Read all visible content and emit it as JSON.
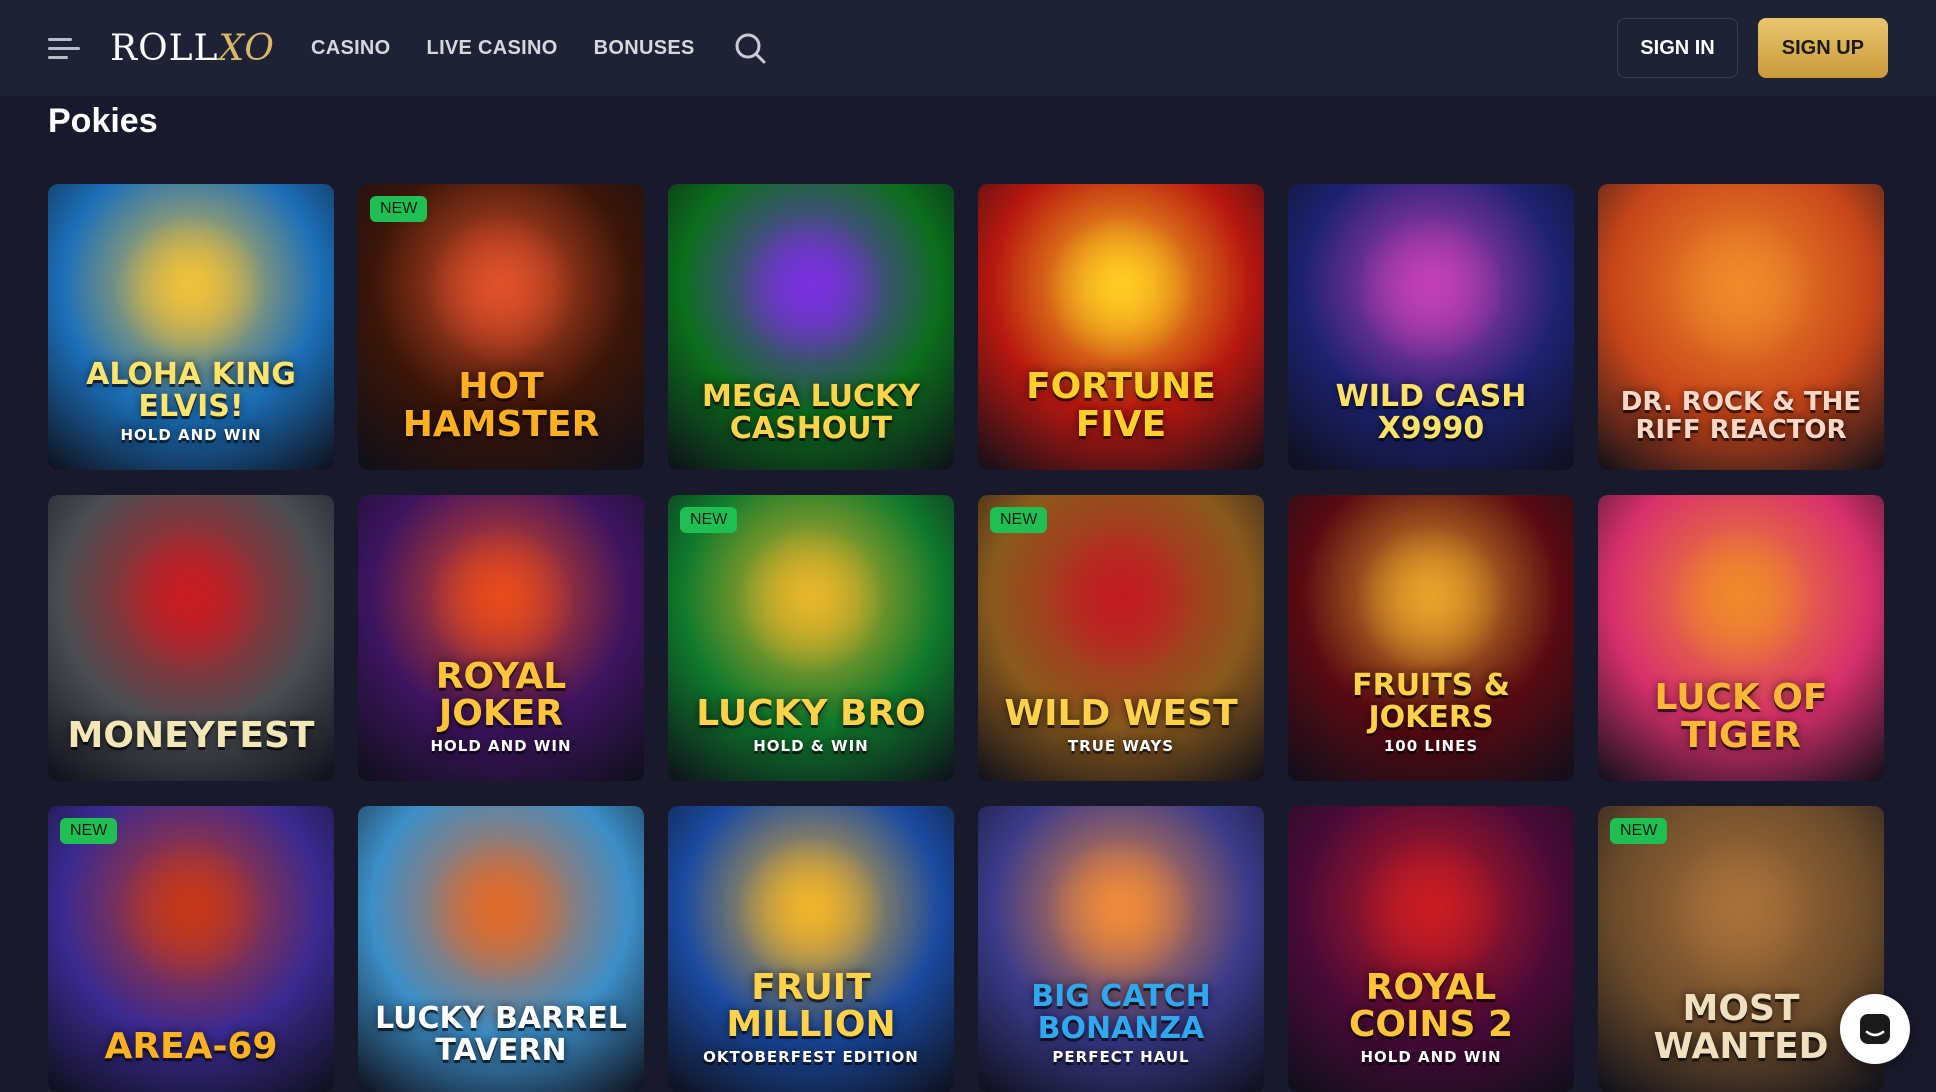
{
  "header": {
    "logo_prefix": "ROLL",
    "logo_suffix": "XO",
    "nav": [
      "CASINO",
      "LIVE CASINO",
      "BONUSES"
    ],
    "sign_in": "SIGN IN",
    "sign_up": "SIGN UP"
  },
  "section": {
    "title": "Pokies"
  },
  "badge_label": "NEW",
  "games": [
    {
      "main": "Aloha King Elvis!",
      "sub": "Hold and Win",
      "new": false,
      "bg": "#1b6fb8",
      "accent": "#f0c13a",
      "color": "#ffe36a"
    },
    {
      "main": "Hot Hamster",
      "sub": "",
      "new": true,
      "bg": "#3a1508",
      "accent": "#e0502a",
      "color": "#ffb020"
    },
    {
      "main": "Mega Lucky Cashout",
      "sub": "",
      "new": false,
      "bg": "#0c6e1c",
      "accent": "#7a2fe0",
      "color": "#ffd34a"
    },
    {
      "main": "Fortune Five",
      "sub": "",
      "new": false,
      "bg": "#b8170f",
      "accent": "#ffcc22",
      "color": "#ffcf2a"
    },
    {
      "main": "Wild Cash x9990",
      "sub": "",
      "new": false,
      "bg": "#1c2270",
      "accent": "#c23fb8",
      "color": "#ffe068"
    },
    {
      "main": "Dr. Rock & The Riff Reactor",
      "sub": "",
      "new": false,
      "bg": "#c8461a",
      "accent": "#f08a2a",
      "color": "#ffd7c7"
    },
    {
      "main": "Moneyfest",
      "sub": "",
      "new": false,
      "bg": "#4a4d52",
      "accent": "#c91c22",
      "color": "#f3e7b7"
    },
    {
      "main": "Royal Joker",
      "sub": "Hold and Win",
      "new": false,
      "bg": "#3e1460",
      "accent": "#e84a1c",
      "color": "#ffc43a"
    },
    {
      "main": "Lucky Bro",
      "sub": "Hold & Win",
      "new": true,
      "bg": "#0f7a2c",
      "accent": "#e7b52a",
      "color": "#ffd24a"
    },
    {
      "main": "Wild West",
      "sub": "True Ways",
      "new": true,
      "bg": "#8a5a1c",
      "accent": "#c21c22",
      "color": "#ffd04a"
    },
    {
      "main": "Fruits & Jokers",
      "sub": "100 Lines",
      "new": false,
      "bg": "#5a0a12",
      "accent": "#e7a22a",
      "color": "#ffd24a"
    },
    {
      "main": "Luck of Tiger",
      "sub": "",
      "new": false,
      "bg": "#d8306c",
      "accent": "#f08a2a",
      "color": "#ffb836"
    },
    {
      "main": "Area-69",
      "sub": "",
      "new": true,
      "bg": "#3a2a90",
      "accent": "#c83818",
      "color": "#ffb220"
    },
    {
      "main": "Lucky Barrel Tavern",
      "sub": "",
      "new": false,
      "bg": "#3c8fc8",
      "accent": "#e06a2a",
      "color": "#ffffff"
    },
    {
      "main": "Fruit Million",
      "sub": "Oktoberfest Edition",
      "new": false,
      "bg": "#1a4aa0",
      "accent": "#f0b42a",
      "color": "#ffd24a"
    },
    {
      "main": "Big Catch Bonanza",
      "sub": "Perfect Haul",
      "new": false,
      "bg": "#3a3a8a",
      "accent": "#f08a3a",
      "color": "#2fa8f0"
    },
    {
      "main": "Royal Coins 2",
      "sub": "Hold and Win",
      "new": false,
      "bg": "#4a0a38",
      "accent": "#c91c22",
      "color": "#ffc43a"
    },
    {
      "main": "Most Wanted",
      "sub": "",
      "new": true,
      "bg": "#6a4a2a",
      "accent": "#a8703a",
      "color": "#f0e0c0"
    }
  ]
}
